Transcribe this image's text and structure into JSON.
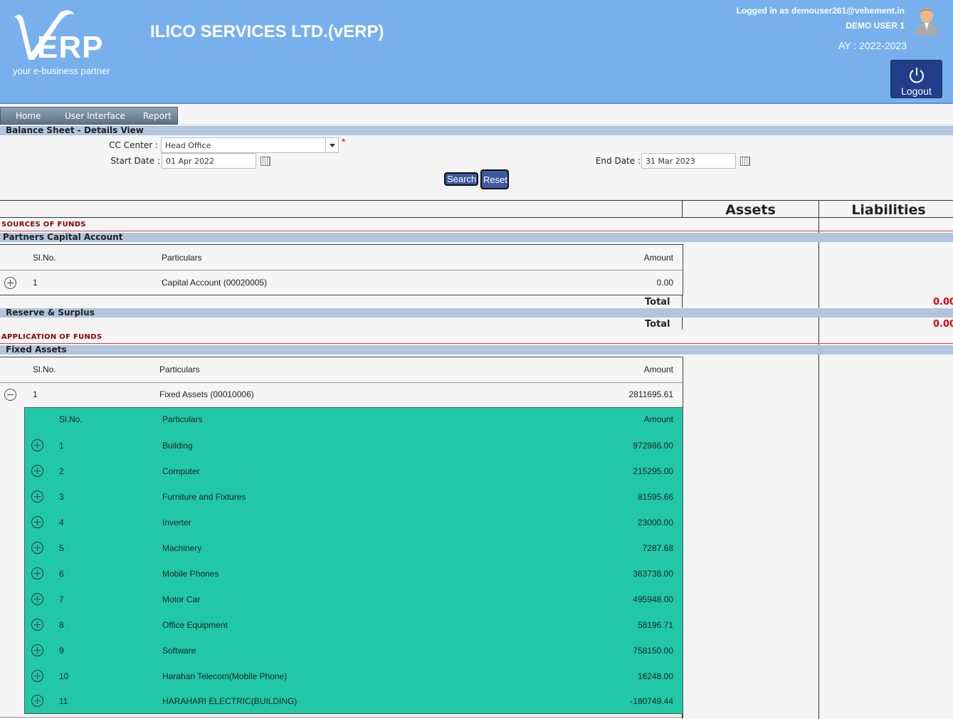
{
  "header": {
    "logo_text": "ERP",
    "logo_tagline": "your e-business partner",
    "app_title": "ILICO SERVICES LTD.(vERP)",
    "logged_in": "Logged in as demouser261@vehement.in",
    "user_name": "DEMO USER 1",
    "ay": "AY : 2022-2023",
    "logout_label": "Logout"
  },
  "menu": {
    "home": "Home",
    "ui": "User Interface",
    "report": "Report"
  },
  "page_title": "Balance Sheet - Details View",
  "filters": {
    "cc_label": "CC Center :",
    "cc_value": "Head Office",
    "start_label": "Start Date :",
    "start_value": "01 Apr 2022",
    "end_label": "End Date :",
    "end_value": "31 Mar 2023",
    "search": "Search",
    "reset": "Reset"
  },
  "columns": {
    "assets": "Assets",
    "liabilities": "Liabilities"
  },
  "sources": {
    "title": "SOURCES OF FUNDS",
    "partners": {
      "title": "Partners Capital Account",
      "headers": {
        "slno": "Sl.No.",
        "particulars": "Particulars",
        "amount": "Amount"
      },
      "row": {
        "slno": "1",
        "particulars": "Capital Account (00020005)",
        "amount": "0.00"
      },
      "total_label": "Total",
      "total_value": "0.00"
    },
    "reserve": {
      "title": "Reserve & Surplus",
      "total_label": "Total",
      "total_value": "0.00"
    }
  },
  "application": {
    "title": "APPLICATION OF FUNDS",
    "fixed": {
      "title": "Fixed Assets",
      "headers": {
        "slno": "Sl.No.",
        "particulars": "Particulars",
        "amount": "Amount"
      },
      "row": {
        "slno": "1",
        "particulars": "Fixed Assets (00010006)",
        "amount": "2811695.61"
      },
      "sub_headers": {
        "slno": "Sl.No.",
        "particulars": "Particulars",
        "amount": "Amount"
      },
      "items": [
        {
          "slno": "1",
          "particulars": "Building",
          "amount": "972986.00"
        },
        {
          "slno": "2",
          "particulars": "Computer",
          "amount": "215295.00"
        },
        {
          "slno": "3",
          "particulars": "Furniture and Fixtures",
          "amount": "81595.66"
        },
        {
          "slno": "4",
          "particulars": "Inverter",
          "amount": "23000.00"
        },
        {
          "slno": "5",
          "particulars": "Machinery",
          "amount": "7287.68"
        },
        {
          "slno": "6",
          "particulars": "Mobile Phones",
          "amount": "363738.00"
        },
        {
          "slno": "7",
          "particulars": "Motor Car",
          "amount": "495948.00"
        },
        {
          "slno": "8",
          "particulars": "Office Equipment",
          "amount": "58196.71"
        },
        {
          "slno": "9",
          "particulars": "Software",
          "amount": "758150.00"
        },
        {
          "slno": "10",
          "particulars": "Harahari Telecom(Mobile Phone)",
          "amount": "16248.00"
        },
        {
          "slno": "11",
          "particulars": "HARAHARI ELECTRIC(BUILDING)",
          "amount": "-180749.44"
        }
      ]
    }
  }
}
